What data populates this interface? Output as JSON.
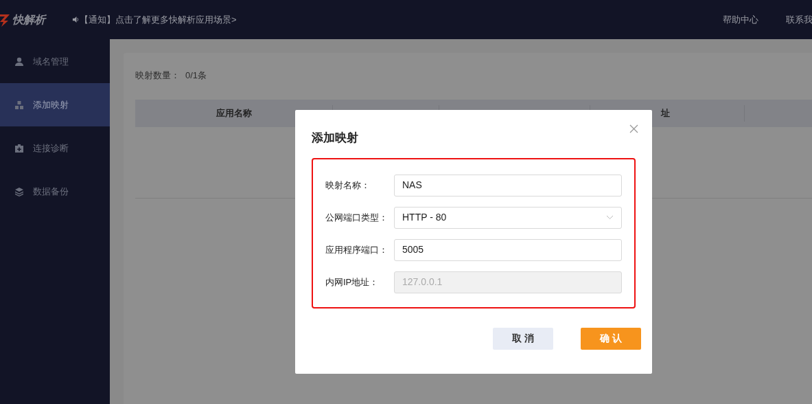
{
  "header": {
    "logo_text": "快解析",
    "notice": "【通知】点击了解更多快解析应用场景>",
    "links": [
      "帮助中心",
      "联系我"
    ]
  },
  "sidebar": {
    "items": [
      {
        "label": "域名管理",
        "selected": false
      },
      {
        "label": "添加映射",
        "selected": true
      },
      {
        "label": "连接诊断",
        "selected": false
      },
      {
        "label": "数据备份",
        "selected": false
      }
    ]
  },
  "content": {
    "count_label": "映射数量：",
    "count_value": "0/1条",
    "table": {
      "columns": [
        "应用名称",
        "",
        "",
        "址",
        ""
      ]
    }
  },
  "dialog": {
    "title": "添加映射",
    "fields": [
      {
        "kind": "input",
        "label": "映射名称：",
        "value": "NAS",
        "disabled": false
      },
      {
        "kind": "select",
        "label": "公网端口类型：",
        "value": "HTTP - 80",
        "disabled": false
      },
      {
        "kind": "input",
        "label": "应用程序端口：",
        "value": "5005",
        "disabled": false
      },
      {
        "kind": "input",
        "label": "内网IP地址：",
        "value": "127.0.0.1",
        "disabled": true
      }
    ],
    "buttons": [
      {
        "label": "取 消",
        "kind": "secondary"
      },
      {
        "label": "确 认",
        "kind": "primary"
      }
    ]
  }
}
